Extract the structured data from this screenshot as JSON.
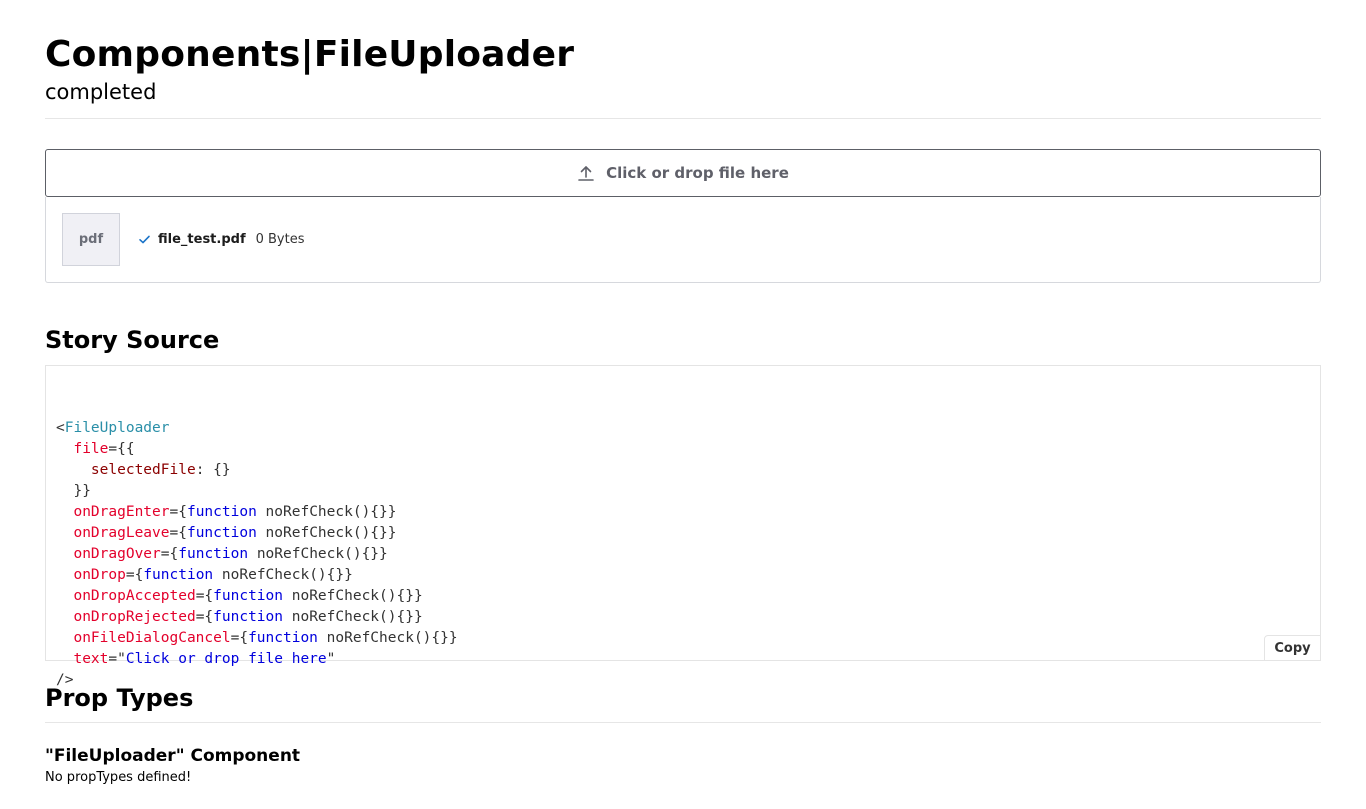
{
  "header": {
    "title": "Components|FileUploader",
    "subtitle": "completed"
  },
  "uploader": {
    "dropzone_text": "Click or drop file here",
    "file": {
      "thumb_label": "pdf",
      "name": "file_test.pdf",
      "size": "0 Bytes"
    }
  },
  "story_source": {
    "title": "Story Source",
    "copy_label": "Copy",
    "lines": [
      [
        {
          "t": "<",
          "c": "plain"
        },
        {
          "t": "FileUploader",
          "c": "tag"
        }
      ],
      [
        {
          "t": "  ",
          "c": "plain"
        },
        {
          "t": "file",
          "c": "attr"
        },
        {
          "t": "={{",
          "c": "plain"
        }
      ],
      [
        {
          "t": "    ",
          "c": "plain"
        },
        {
          "t": "selectedFile",
          "c": "prop"
        },
        {
          "t": ": {}",
          "c": "plain"
        }
      ],
      [
        {
          "t": "  }}",
          "c": "plain"
        }
      ],
      [
        {
          "t": "  ",
          "c": "plain"
        },
        {
          "t": "onDragEnter",
          "c": "attr"
        },
        {
          "t": "={",
          "c": "plain"
        },
        {
          "t": "function",
          "c": "kw"
        },
        {
          "t": " noRefCheck(){}}",
          "c": "plain"
        }
      ],
      [
        {
          "t": "  ",
          "c": "plain"
        },
        {
          "t": "onDragLeave",
          "c": "attr"
        },
        {
          "t": "={",
          "c": "plain"
        },
        {
          "t": "function",
          "c": "kw"
        },
        {
          "t": " noRefCheck(){}}",
          "c": "plain"
        }
      ],
      [
        {
          "t": "  ",
          "c": "plain"
        },
        {
          "t": "onDragOver",
          "c": "attr"
        },
        {
          "t": "={",
          "c": "plain"
        },
        {
          "t": "function",
          "c": "kw"
        },
        {
          "t": " noRefCheck(){}}",
          "c": "plain"
        }
      ],
      [
        {
          "t": "  ",
          "c": "plain"
        },
        {
          "t": "onDrop",
          "c": "attr"
        },
        {
          "t": "={",
          "c": "plain"
        },
        {
          "t": "function",
          "c": "kw"
        },
        {
          "t": " noRefCheck(){}}",
          "c": "plain"
        }
      ],
      [
        {
          "t": "  ",
          "c": "plain"
        },
        {
          "t": "onDropAccepted",
          "c": "attr"
        },
        {
          "t": "={",
          "c": "plain"
        },
        {
          "t": "function",
          "c": "kw"
        },
        {
          "t": " noRefCheck(){}}",
          "c": "plain"
        }
      ],
      [
        {
          "t": "  ",
          "c": "plain"
        },
        {
          "t": "onDropRejected",
          "c": "attr"
        },
        {
          "t": "={",
          "c": "plain"
        },
        {
          "t": "function",
          "c": "kw"
        },
        {
          "t": " noRefCheck(){}}",
          "c": "plain"
        }
      ],
      [
        {
          "t": "  ",
          "c": "plain"
        },
        {
          "t": "onFileDialogCancel",
          "c": "attr"
        },
        {
          "t": "={",
          "c": "plain"
        },
        {
          "t": "function",
          "c": "kw"
        },
        {
          "t": " noRefCheck(){}}",
          "c": "plain"
        }
      ],
      [
        {
          "t": "  ",
          "c": "plain"
        },
        {
          "t": "text",
          "c": "attr"
        },
        {
          "t": "=\"",
          "c": "plain"
        },
        {
          "t": "Click or drop file here",
          "c": "str"
        },
        {
          "t": "\"",
          "c": "plain"
        }
      ],
      [
        {
          "t": "/>",
          "c": "plain"
        }
      ]
    ]
  },
  "prop_types": {
    "title": "Prop Types",
    "component_name": "\"FileUploader\" Component",
    "message": "No propTypes defined!"
  },
  "colors": {
    "tag": "#2a8fa8",
    "attr": "#e3002b",
    "prop": "#8b0000",
    "keyword": "#0000dd",
    "check": "#1a73c8"
  },
  "icons": {
    "dropzone": "upload-icon",
    "file_status": "check-icon"
  }
}
